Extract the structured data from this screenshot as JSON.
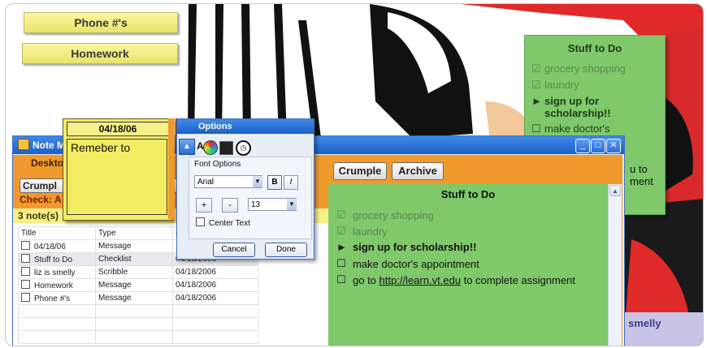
{
  "tabs": {
    "phone": "Phone #'s",
    "homework": "Homework"
  },
  "bg_note": {
    "title": "Stuff to Do",
    "items": [
      {
        "mark": "☑",
        "text": "grocery shopping"
      },
      {
        "mark": "☑",
        "text": "laundry"
      },
      {
        "mark": "►",
        "text": "sign up for scholarship!!"
      },
      {
        "mark": "☐",
        "text": "make doctor's"
      }
    ],
    "fragments": {
      "a": "u to",
      "b": "ment"
    }
  },
  "manager": {
    "title": "Note M",
    "section": "Deskto",
    "crumple_label": "Crumpl",
    "check_label": "Check:",
    "check_tail": "A",
    "count_label": "3 note(s)",
    "columns": [
      "Title",
      "Type",
      "s"
    ],
    "rows": [
      {
        "title": "04/18/06",
        "type": "Message",
        "date": ""
      },
      {
        "title": "Stuff to Do",
        "type": "Checklist",
        "date": "04/18/2006"
      },
      {
        "title": "liz is smelly",
        "type": "Scribble",
        "date": "04/18/2006"
      },
      {
        "title": "Homework",
        "type": "Message",
        "date": "04/18/2006"
      },
      {
        "title": "Phone #'s",
        "type": "Message",
        "date": "04/18/2006"
      }
    ]
  },
  "yellow_note": {
    "date": "04/18/06",
    "text": "Remeber to"
  },
  "options": {
    "title": "Options",
    "font_options_label": "Font Options",
    "font_value": "Arial",
    "bold_label": "B",
    "italic_label": "I",
    "plus_label": "+",
    "minus_label": "-",
    "size_value": "13",
    "center_text_label": "Center Text",
    "cancel_label": "Cancel",
    "done_label": "Done"
  },
  "main_note": {
    "crumple_label": "Crumple",
    "archive_label": "Archive",
    "title": "Stuff to Do",
    "items": [
      {
        "mark": "☑",
        "text": "grocery shopping"
      },
      {
        "mark": "☑",
        "text": "laundry"
      },
      {
        "mark": "►",
        "text": "sign up for scholarship!!"
      },
      {
        "mark": "☐",
        "text": "make doctor's appointment"
      }
    ],
    "last_item": {
      "mark": "☐",
      "prefix": "go to ",
      "link": "http://learn.vt.edu",
      "suffix": " to complete assignment"
    }
  },
  "smelly_fragment": "smelly",
  "colors": {
    "titlebar": "#1c5fc8",
    "orange": "#f09a2e",
    "note_green": "#7fc96a",
    "yellow_note": "#f2ec62",
    "close_red": "#d8392b"
  }
}
